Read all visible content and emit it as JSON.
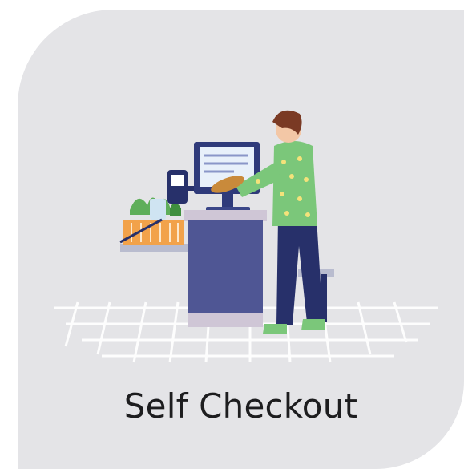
{
  "tile": {
    "label": "Self Checkout",
    "illustration_icon": "self-checkout-illustration-icon"
  },
  "colors": {
    "tile_background": "#e4e4e7",
    "kiosk_body": "#4f5694",
    "monitor_frame": "#2f3a7a",
    "shirt": "#7bc77a",
    "pants": "#27306a",
    "hair": "#7a3a24",
    "basket": "#f2a24a",
    "floor_grid": "#ffffff",
    "label_text": "#1d1d1f"
  }
}
